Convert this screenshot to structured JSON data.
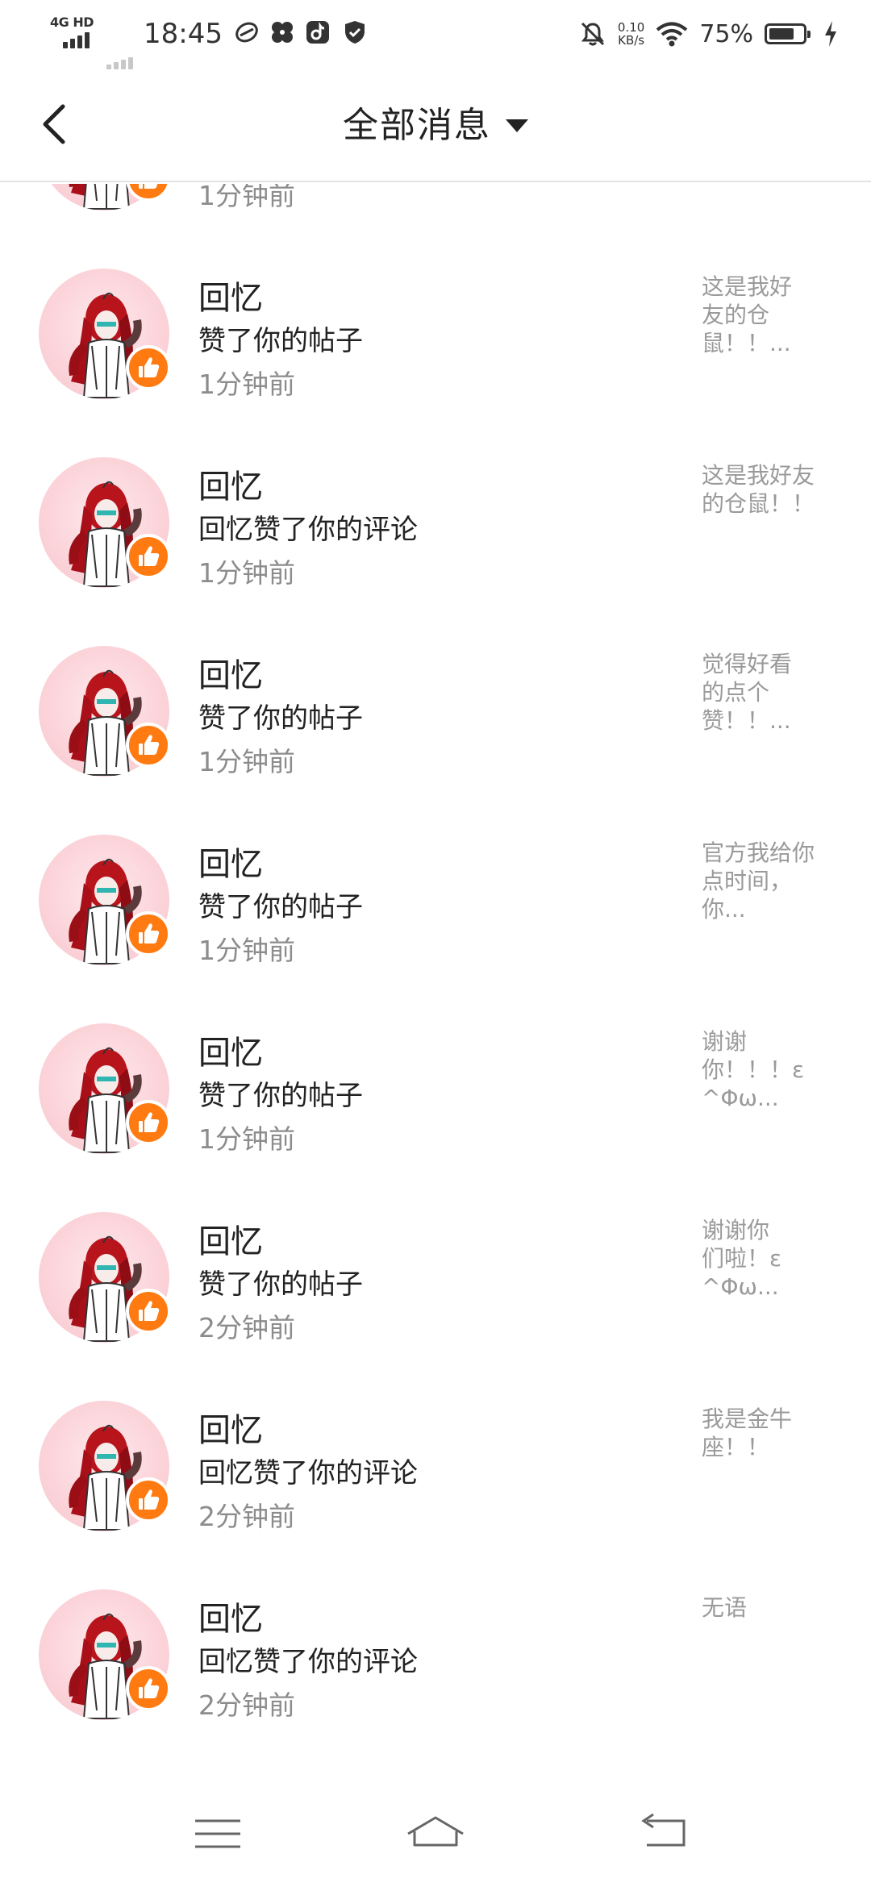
{
  "status_bar": {
    "network_type": "4G HD",
    "time": "18:45",
    "net_speed_value": "0.10",
    "net_speed_unit": "KB/s",
    "battery_percent": "75%",
    "battery_level": 0.75
  },
  "header": {
    "title": "全部消息"
  },
  "messages": [
    {
      "time": "1分钟前"
    },
    {
      "name": "回忆",
      "action": "赞了你的帖子",
      "time": "1分钟前",
      "preview": "这是我好\n友的仓\n鼠！！..."
    },
    {
      "name": "回忆",
      "action": "回忆赞了你的评论",
      "time": "1分钟前",
      "preview": "这是我好友\n的仓鼠！！"
    },
    {
      "name": "回忆",
      "action": "赞了你的帖子",
      "time": "1分钟前",
      "preview": "觉得好看\n的点个\n赞！！..."
    },
    {
      "name": "回忆",
      "action": "赞了你的帖子",
      "time": "1分钟前",
      "preview": "官方我给你\n点时间，\n你..."
    },
    {
      "name": "回忆",
      "action": "赞了你的帖子",
      "time": "1分钟前",
      "preview": "谢谢\n你！！！ε\n^Φω..."
    },
    {
      "name": "回忆",
      "action": "赞了你的帖子",
      "time": "2分钟前",
      "preview": "谢谢你\n们啦！ε\n^Φω..."
    },
    {
      "name": "回忆",
      "action": "回忆赞了你的评论",
      "time": "2分钟前",
      "preview": "我是金牛\n座！！"
    },
    {
      "name": "回忆",
      "action": "回忆赞了你的评论",
      "time": "2分钟前",
      "preview": "无语"
    }
  ],
  "colors": {
    "like_badge": "#ff7a10",
    "avatar_bg": "#fbd3d9",
    "secondary_text": "#8c8c8c"
  }
}
